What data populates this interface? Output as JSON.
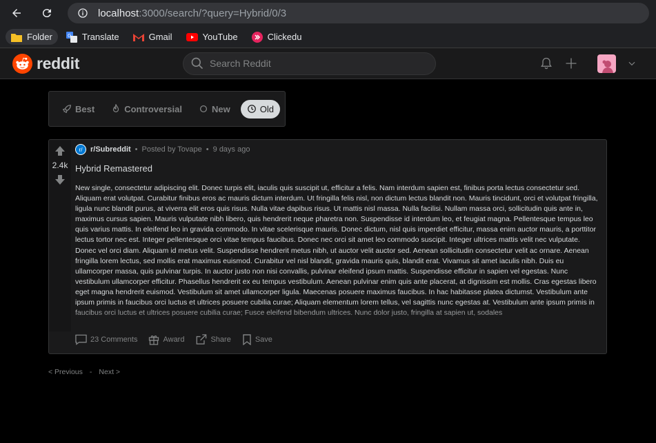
{
  "browser": {
    "url_host": "localhost",
    "url_path": ":3000/search/?query=Hybrid/0/3",
    "bookmarks": [
      "Folder",
      "Translate",
      "Gmail",
      "YouTube",
      "Clickedu"
    ]
  },
  "header": {
    "logo_text": "reddit",
    "search_placeholder": "Search Reddit"
  },
  "sort": {
    "options": [
      "Best",
      "Controversial",
      "New",
      "Old"
    ],
    "active": "Old"
  },
  "post": {
    "subreddit": "r/Subreddit",
    "posted_by": "Posted by Tovape",
    "age": "9 days ago",
    "score": "2.4k",
    "title": "Hybrid Remastered",
    "body": "New single, consectetur adipiscing elit. Donec turpis elit, iaculis quis suscipit ut, efficitur a felis. Nam interdum sapien est, finibus porta lectus consectetur sed. Aliquam erat volutpat. Curabitur finibus eros ac mauris dictum interdum. Ut fringilla felis nisl, non dictum lectus blandit non. Mauris tincidunt, orci et volutpat fringilla, ligula nunc blandit purus, at viverra elit eros quis risus. Nulla vitae dapibus risus. Ut mattis nisl massa. Nulla facilisi. Nullam massa orci, sollicitudin quis ante in, maximus cursus sapien. Mauris vulputate nibh libero, quis hendrerit neque pharetra non. Suspendisse id interdum leo, et feugiat magna. Pellentesque tempus leo quis varius mattis. In eleifend leo in gravida commodo. In vitae scelerisque mauris. Donec dictum, nisl quis imperdiet efficitur, massa enim auctor mauris, a porttitor lectus tortor nec est. Integer pellentesque orci vitae tempus faucibus. Donec nec orci sit amet leo commodo suscipit. Integer ultrices mattis velit nec vulputate. Donec vel orci diam. Aliquam id metus velit. Suspendisse hendrerit metus nibh, ut auctor velit auctor sed. Aenean sollicitudin consectetur velit ac ornare. Aenean fringilla lorem lectus, sed mollis erat maximus euismod. Curabitur vel nisl blandit, gravida mauris quis, blandit erat. Vivamus sit amet iaculis nibh. Duis eu ullamcorper massa, quis pulvinar turpis. In auctor justo non nisi convallis, pulvinar eleifend ipsum mattis. Suspendisse efficitur in sapien vel egestas. Nunc vestibulum ullamcorper efficitur. Phasellus hendrerit ex eu tempus vestibulum. Aenean pulvinar enim quis ante placerat, at dignissim est mollis. Cras egestas libero eget magna hendrerit euismod. Vestibulum sit amet ullamcorper ligula. Maecenas posuere maximus faucibus. In hac habitasse platea dictumst. Vestibulum ante ipsum primis in faucibus orci luctus et ultrices posuere cubilia curae; Aliquam elementum lorem tellus, vel sagittis nunc egestas at. Vestibulum ante ipsum primis in faucibus orci luctus et ultrices posuere cubilia curae; Fusce eleifend bibendum ultrices. Nunc dolor justo, fringilla at sapien ut, sodales",
    "comments": "23 Comments",
    "award": "Award",
    "share": "Share",
    "save": "Save"
  },
  "pagination": {
    "previous": "< Previous",
    "separator": "-",
    "next": "Next >"
  },
  "colors": {
    "reddit_orange": "#ff4500",
    "background": "#000000",
    "card": "#1a1a1b",
    "border": "#343536"
  }
}
